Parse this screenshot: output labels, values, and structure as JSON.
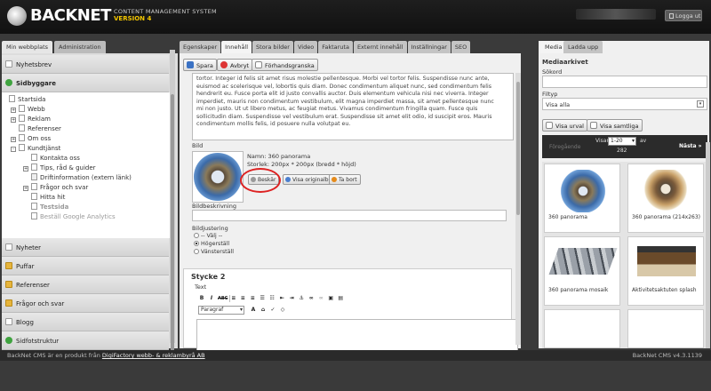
{
  "header": {
    "brand": "BACKNET",
    "subtitle": "CONTENT MANAGEMENT SYSTEM",
    "version": "VERSION 4",
    "logout": "Logga ut"
  },
  "left": {
    "tabs": [
      "Min webbplats",
      "Administration"
    ],
    "items_top": [
      {
        "label": "Nyhetsbrev",
        "icon": "page-icon"
      },
      {
        "label": "Sidbyggare",
        "icon": "section-dot-icon"
      }
    ],
    "tree": [
      "Startsida",
      "Webb",
      "Reklam",
      "Referenser",
      "Om oss",
      "Kundtjänst",
      "Kontakta oss",
      "Tips, råd & guider",
      "Driftinformation (extern länk)",
      "Frågor och svar",
      "Hitta hit",
      "Testsida",
      "Beställ Google Analytics"
    ],
    "items_bottom": [
      {
        "label": "Nyheter",
        "icon": "page-icon"
      },
      {
        "label": "Puffar",
        "icon": "folder-icon"
      },
      {
        "label": "Referenser",
        "icon": "folder-icon"
      },
      {
        "label": "Frågor och svar",
        "icon": "folder-icon"
      },
      {
        "label": "Blogg",
        "icon": "page-icon"
      },
      {
        "label": "Sidfotstruktur",
        "icon": "section-dot-icon"
      }
    ]
  },
  "center": {
    "tabs": [
      "Egenskaper",
      "Innehåll",
      "Stora bilder",
      "Video",
      "Faktaruta",
      "Externt innehåll",
      "Inställningar",
      "SEO"
    ],
    "active_tab": "Innehåll",
    "buttons": {
      "save": "Spara",
      "cancel": "Avbryt",
      "preview": "Förhandsgranska"
    },
    "body_text": "tortor. Integer id felis sit amet risus molestie pellentesque. Morbi vel tortor felis. Suspendisse nunc ante, euismod ac scelerisque vel, lobortis quis diam. Donec condimentum aliquet nunc, sed condimentum felis hendrerit eu. Fusce porta elit id justo convallis auctor. Duis elementum vehicula nisi nec viverra. Integer imperdiet, mauris non condimentum vestibulum, elit magna imperdiet massa, sit amet pellentesque nunc mi non justo. Ut ut libero metus, ac feugiat metus. Vivamus condimentum fringilla quam. Fusce quis sollicitudin diam. Suspendisse vel vestibulum erat. Suspendisse sit amet elit odio, id suscipit eros. Mauris condimentum mollis felis, id posuere nulla volutpat eu.",
    "image": {
      "label": "Bild",
      "name": "Namn: 360 panorama",
      "size": "Storlek: 200px * 200px (bredd * höjd)",
      "crop": "Beskär",
      "original": "Visa originalbild",
      "remove": "Ta bort"
    },
    "desc_label": "Bildbeskrivning",
    "align": {
      "label": "Bildjustering",
      "options": [
        "-- Välj --",
        "Högerställ",
        "Vänsterställ"
      ],
      "selected": 1
    },
    "section": {
      "title": "Stycke 2",
      "text_label": "Text",
      "format": "Paragraf"
    },
    "toolbar": [
      "B",
      "I",
      "ABC"
    ]
  },
  "right": {
    "tabs": [
      "Media",
      "Ladda upp"
    ],
    "title": "Mediaarkivet",
    "search_label": "Sökord",
    "type_label": "Filtyp",
    "type_value": "Visa alla",
    "btn_list": "Visa urval",
    "btn_all": "Visa samtliga",
    "pager": {
      "prev": "Föregående",
      "show": "Visar",
      "range": "1-20",
      "of": "av",
      "total": "282",
      "next": "Nästa »"
    },
    "items": [
      {
        "caption": "360 panorama"
      },
      {
        "caption": "360 panorama (214x263)"
      },
      {
        "caption": "360 panorama mosaik"
      },
      {
        "caption": "Aktivitetsaktuten splash"
      }
    ]
  },
  "footer": {
    "prefix": "BackNet CMS är en produkt från",
    "link": "DigiFactory webb- & reklambyrå AB",
    "version": "BackNet CMS v4.3.1139"
  }
}
